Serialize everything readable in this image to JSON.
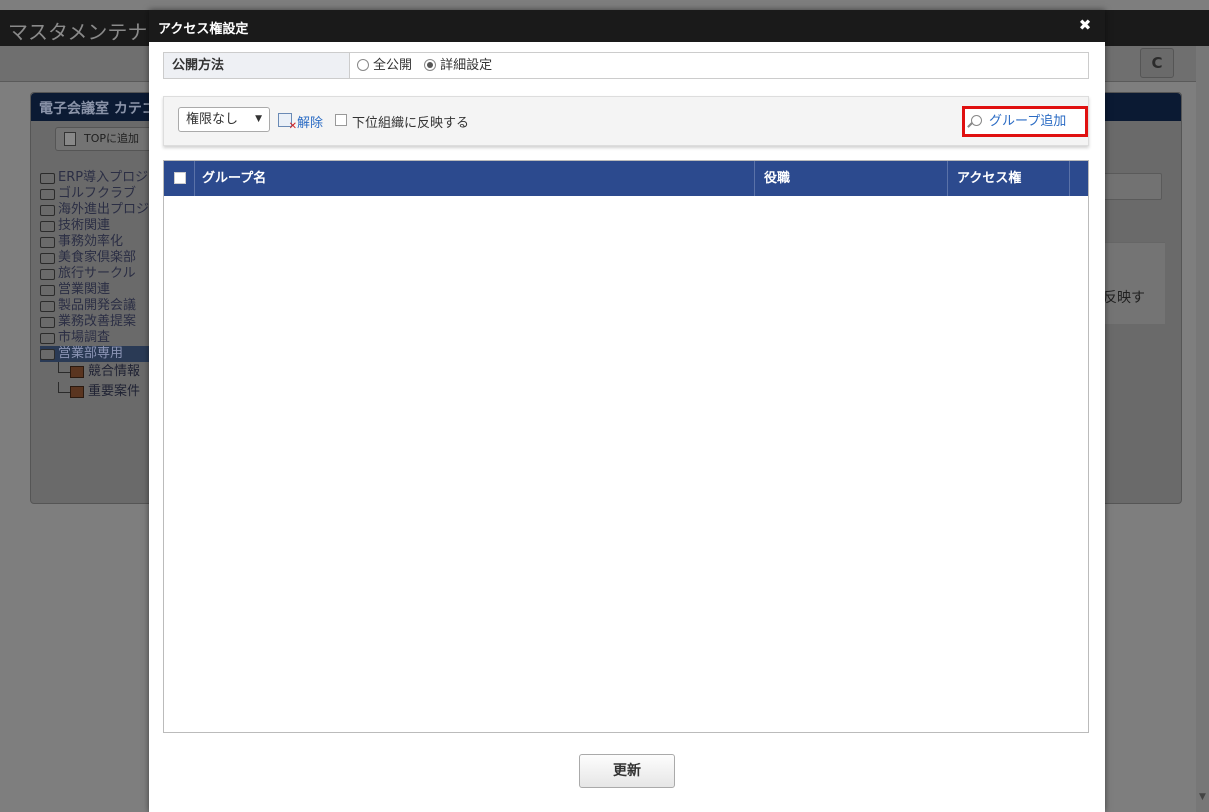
{
  "background": {
    "app_title": "マスタメンテナンス",
    "panel_title": "電子会議室 カテゴリ",
    "top_button_label": "TOPに追加",
    "tree_items": [
      "ERP導入プロジェクト",
      "ゴルフクラブ",
      "海外進出プロジェクト",
      "技術関連",
      "事務効率化",
      "美食家倶楽部",
      "旅行サークル",
      "営業関連",
      "製品開発会議",
      "業務改善提案",
      "市場調査",
      "営業部専用"
    ],
    "tree_sub_items": [
      "競合情報",
      "重要案件"
    ],
    "reflect_text": "反映す",
    "refresh_icon": "refresh-icon"
  },
  "modal": {
    "title": "アクセス権設定",
    "close_label": "✖",
    "publish": {
      "label": "公開方法",
      "options": [
        {
          "label": "全公開",
          "checked": false
        },
        {
          "label": "詳細設定",
          "checked": true
        }
      ]
    },
    "toolbar": {
      "permission_select_value": "権限なし",
      "clear_label": "解除",
      "subgroup_label": "下位組織に反映する",
      "group_add_label": "グループ追加"
    },
    "table": {
      "headers": [
        "グループ名",
        "役職",
        "アクセス権"
      ],
      "rows": []
    },
    "update_button_label": "更新"
  },
  "colors": {
    "header_dark": "#1a1a1a",
    "table_header_blue": "#2c4a8e",
    "link_blue": "#2a6bc4",
    "highlight_red": "#e01010"
  }
}
